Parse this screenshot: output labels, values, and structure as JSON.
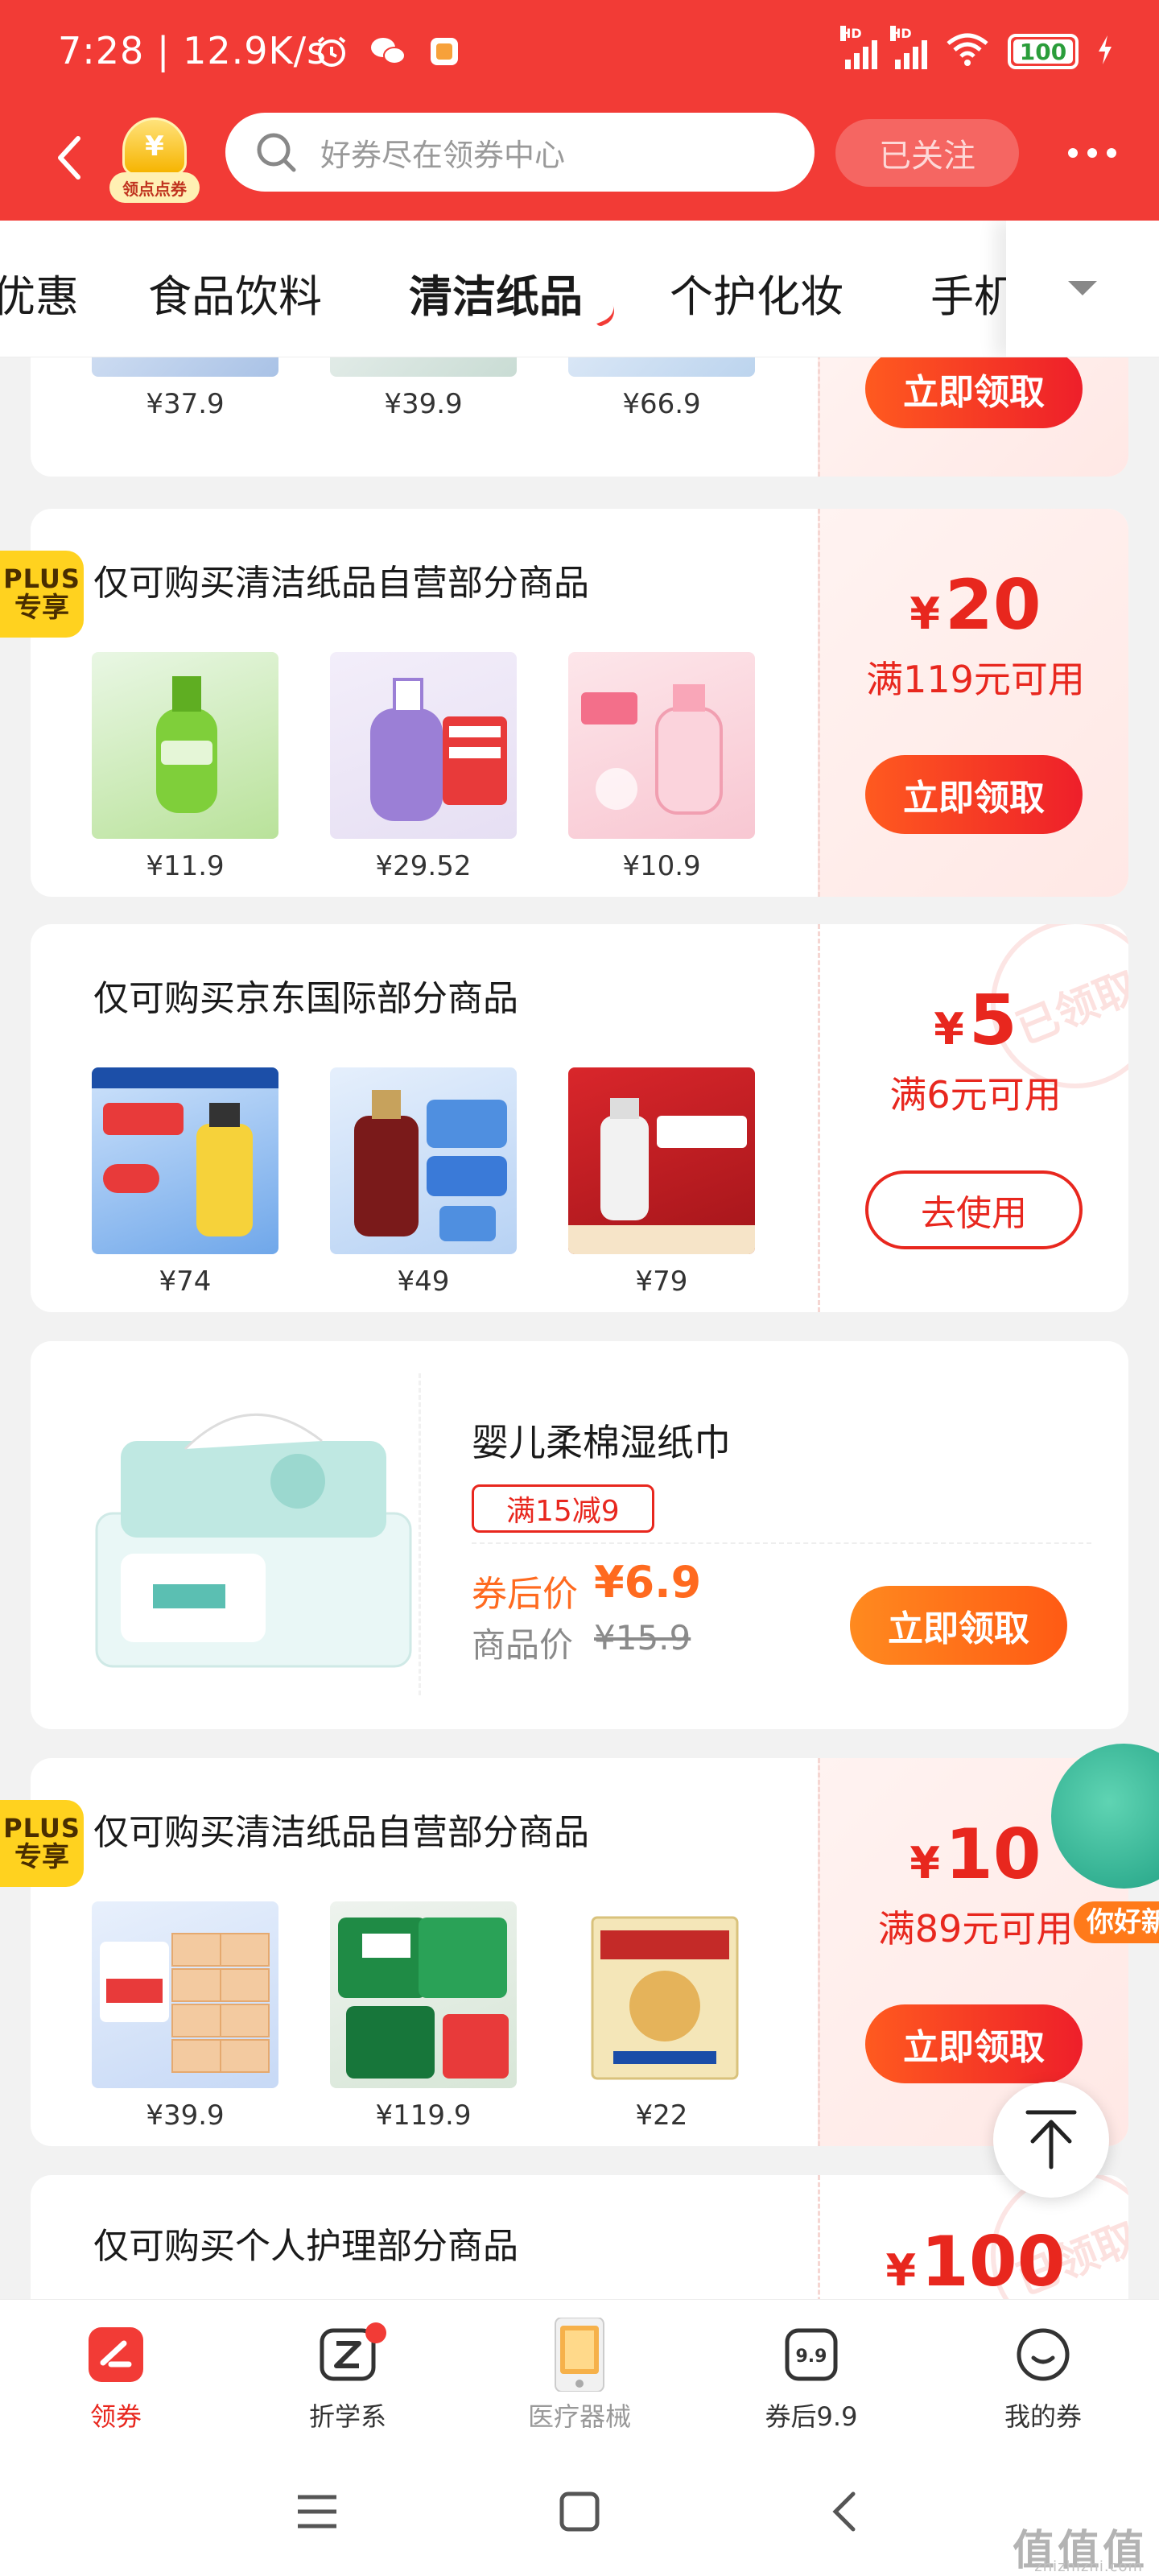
{
  "status_bar": {
    "time": "7:28",
    "speed": "12.9K/s",
    "signal_tag": "HD",
    "battery": "100"
  },
  "header": {
    "badge_label": "领点点券",
    "badge_symbol": "¥",
    "search_placeholder": "好券尽在领券中心",
    "follow_label": "已关注"
  },
  "tabs": {
    "items": [
      "优惠",
      "食品饮料",
      "清洁纸品",
      "个护化妆",
      "手机"
    ],
    "active": "清洁纸品"
  },
  "cards": {
    "card0": {
      "prices": [
        "¥37.9",
        "¥39.9",
        "¥66.9"
      ],
      "button": "立即领取"
    },
    "card1": {
      "plus_top": "PLUS",
      "plus_bottom": "专享",
      "title": "仅可购买清洁纸品自营部分商品",
      "prices": [
        "¥11.9",
        "¥29.52",
        "¥10.9"
      ],
      "amount_symbol": "¥",
      "amount": "20",
      "condition": "满119元可用",
      "button": "立即领取"
    },
    "card2": {
      "title": "仅可购买京东国际部分商品",
      "prices": [
        "¥74",
        "¥49",
        "¥79"
      ],
      "amount_symbol": "¥",
      "amount": "5",
      "condition": "满6元可用",
      "button": "去使用",
      "stamp": "已领取"
    },
    "card3": {
      "title": "婴儿柔棉湿纸巾",
      "tag": "满15减9",
      "after_label": "券后价",
      "after_price": "¥6.9",
      "orig_label": "商品价",
      "orig_price": "¥15.9",
      "button": "立即领取"
    },
    "card4": {
      "plus_top": "PLUS",
      "plus_bottom": "专享",
      "title": "仅可购买清洁纸品自营部分商品",
      "prices": [
        "¥39.9",
        "¥119.9",
        "¥22"
      ],
      "amount_symbol": "¥",
      "amount": "10",
      "condition": "满89元可用",
      "button": "立即领取"
    },
    "card5": {
      "title": "仅可购买个人护理部分商品",
      "amount_symbol": "¥",
      "amount": "100",
      "stamp": "已领取"
    }
  },
  "floating": {
    "promo_text": "你好新"
  },
  "bottom_bar": {
    "items": [
      "领券",
      "折学系",
      "医疗器械",
      "券后9.9",
      "我的券"
    ],
    "active": "领券",
    "badge_99": "9.9"
  },
  "watermark": {
    "main": "值值值",
    "sub": "zhizhizhi.com"
  },
  "colors": {
    "brand_red": "#f23b36",
    "price_red": "#e8271e",
    "orange": "#ff6a1f",
    "plus_yellow": "#ffd21f"
  }
}
